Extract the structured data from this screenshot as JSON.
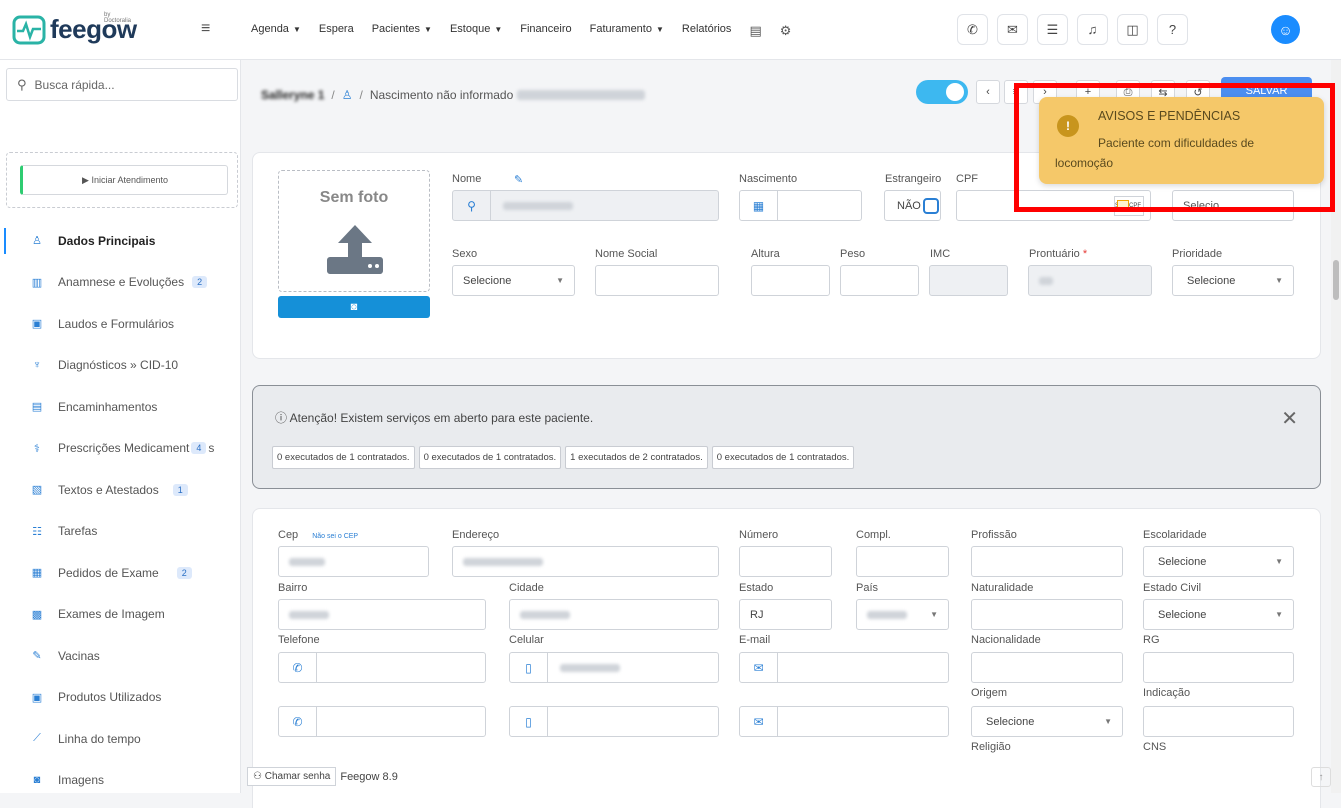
{
  "brand": {
    "name": "feegow",
    "by": "by Doctoralia"
  },
  "nav": {
    "items": [
      {
        "label": "Agenda",
        "caret": true
      },
      {
        "label": "Espera",
        "caret": false
      },
      {
        "label": "Pacientes",
        "caret": true
      },
      {
        "label": "Estoque",
        "caret": true
      },
      {
        "label": "Financeiro",
        "caret": false
      },
      {
        "label": "Faturamento",
        "caret": true
      },
      {
        "label": "Relatórios",
        "caret": false
      }
    ]
  },
  "search": {
    "placeholder": "Busca rápida..."
  },
  "sidebar": {
    "start_button": "▶ Iniciar Atendimento",
    "items": [
      {
        "label": "Dados Principais",
        "icon": "user-icon",
        "badge": ""
      },
      {
        "label": "Anamnese e Evoluções",
        "icon": "chart-icon",
        "badge": "2"
      },
      {
        "label": "Laudos e Formulários",
        "icon": "clipboard-icon",
        "badge": ""
      },
      {
        "label": "Diagnósticos » CID-10",
        "icon": "stethoscope-icon",
        "badge": ""
      },
      {
        "label": "Encaminhamentos",
        "icon": "file-icon",
        "badge": ""
      },
      {
        "label": "Prescrições Medicament",
        "icon": "pills-icon",
        "badge": "4",
        "suffix": "s"
      },
      {
        "label": "Textos e Atestados",
        "icon": "document-icon",
        "badge": "1"
      },
      {
        "label": "Tarefas",
        "icon": "tasks-icon",
        "badge": ""
      },
      {
        "label": "Pedidos de Exame",
        "icon": "exam-icon",
        "badge": "2"
      },
      {
        "label": "Exames de Imagem",
        "icon": "image-exam-icon",
        "badge": ""
      },
      {
        "label": "Vacinas",
        "icon": "syringe-icon",
        "badge": ""
      },
      {
        "label": "Produtos Utilizados",
        "icon": "box-icon",
        "badge": ""
      },
      {
        "label": "Linha do tempo",
        "icon": "timeline-icon",
        "badge": ""
      },
      {
        "label": "Imagens",
        "icon": "camera-icon",
        "badge": ""
      }
    ]
  },
  "breadcrumb": {
    "patient": "Salleryne 1",
    "separator": "/",
    "birth": "Nascimento não informado"
  },
  "header": {
    "save": "SALVAR"
  },
  "form": {
    "photo": {
      "title": "Sem foto"
    },
    "nome": {
      "label": "Nome"
    },
    "nascimento": {
      "label": "Nascimento"
    },
    "estrangeiro": {
      "label": "Estrangeiro",
      "value": "NÃO"
    },
    "cpf": {
      "label": "CPF",
      "sem_cpf": "Sem CPF",
      "select": "Selecio"
    },
    "sexo": {
      "label": "Sexo",
      "value": "Selecione"
    },
    "nome_social": {
      "label": "Nome Social"
    },
    "altura": {
      "label": "Altura"
    },
    "peso": {
      "label": "Peso"
    },
    "imc": {
      "label": "IMC"
    },
    "prontuario": {
      "label": "Prontuário",
      "required": "*"
    },
    "prioridade": {
      "label": "Prioridade",
      "value": "Selecione"
    }
  },
  "warning": {
    "text": "ⓘ Atenção! Existem serviços em aberto para este paciente.",
    "chips": [
      "0 executados de 1 contratados.",
      "0 executados de 1 contratados.",
      "1 executados de 2 contratados.",
      "0 executados de 1 contratados."
    ]
  },
  "address": {
    "cep": "Cep",
    "cep_link": "Não sei o CEP",
    "endereco": "Endereço",
    "numero": "Número",
    "compl": "Compl.",
    "profissao": "Profissão",
    "escolaridade": "Escolaridade",
    "escolaridade_value": "Selecione",
    "bairro": "Bairro",
    "cidade": "Cidade",
    "estado": "Estado",
    "estado_value": "RJ",
    "pais": "País",
    "naturalidade": "Naturalidade",
    "estado_civil": "Estado Civil",
    "estado_civil_value": "Selecione",
    "telefone": "Telefone",
    "celular": "Celular",
    "email": "E-mail",
    "nacionalidade": "Nacionalidade",
    "rg": "RG",
    "origem": "Origem",
    "origem_value": "Selecione",
    "indicacao": "Indicação",
    "religiao": "Religião",
    "cns": "CNS"
  },
  "footer": {
    "call_button": "Chamar senha",
    "version": "Feegow 8.9"
  },
  "toast": {
    "title": "AVISOS E PENDÊNCIAS",
    "message": "Paciente com dificuldades de locomoção"
  }
}
